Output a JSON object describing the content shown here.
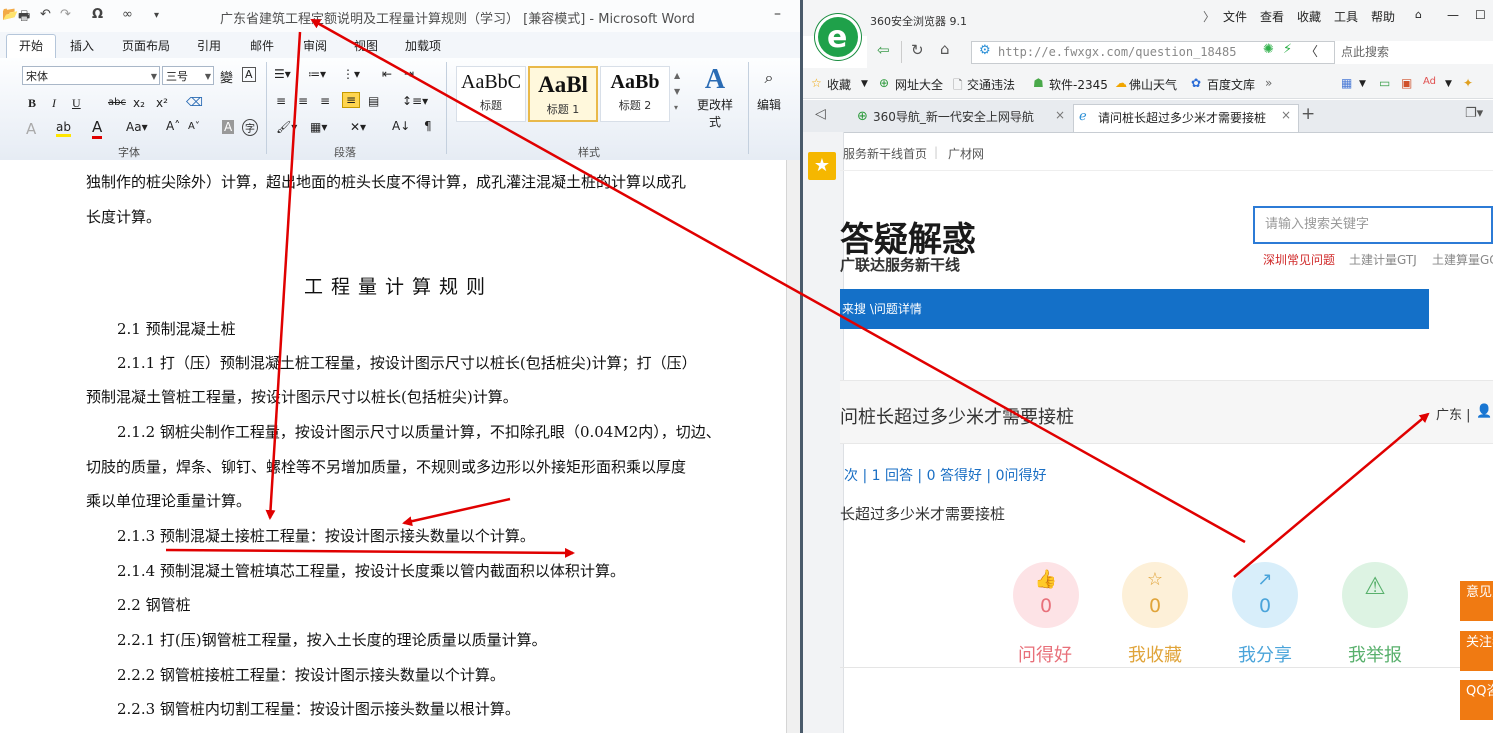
{
  "word": {
    "title": "广东省建筑工程定额说明及工程量计算规则（学习） [兼容模式] - Microsoft Word",
    "tabs": [
      "开始",
      "插入",
      "页面布局",
      "引用",
      "邮件",
      "审阅",
      "视图",
      "加载项"
    ],
    "font_name": "宋体",
    "font_size": "三号",
    "font_group_label": "字体",
    "paragraph_group_label": "段落",
    "styles_group_label": "样式",
    "styles": [
      {
        "sample": "AaBbC",
        "name": "标题"
      },
      {
        "sample": "AaBl",
        "name": "标题 1"
      },
      {
        "sample": "AaBb",
        "name": "标题 2"
      }
    ],
    "change_styles": "更改样式",
    "edit": "编辑",
    "doc_lines": [
      "独制作的桩尖除外）计算，超出地面的桩头长度不得计算，成孔灌注混凝土桩的计算以成孔",
      "长度计算。",
      "工程量计算规则",
      "2.1 预制混凝土桩",
      "2.1.1 打（压）预制混凝土桩工程量，按设计图示尺寸以桩长(包括桩尖)计算；打（压）",
      "预制混凝土管桩工程量，按设计图示尺寸以桩长(包括桩尖)计算。",
      "2.1.2 钢桩尖制作工程量，按设计图示尺寸以质量计算，不扣除孔眼（0.04M2内），切边、",
      "切肢的质量，焊条、铆钉、螺栓等不另增加质量，不规则或多边形以外接矩形面积乘以厚度",
      "乘以单位理论重量计算。",
      "2.1.3 预制混凝土接桩工程量：按设计图示接头数量以个计算。",
      "2.1.4 预制混凝土管桩填芯工程量，按设计长度乘以管内截面积以体积计算。",
      "2.2 钢管桩",
      "2.2.1 打(压)钢管桩工程量，按入土长度的理论质量以质量计算。",
      "2.2.2 钢管桩接桩工程量：按设计图示接头数量以个计算。",
      "2.2.3 钢管桩内切割工程量：按设计图示接头数量以根计算。"
    ]
  },
  "browser": {
    "title": "360安全浏览器 9.1",
    "menu": [
      "文件",
      "查看",
      "收藏",
      "工具",
      "帮助"
    ],
    "url": "http://e.fwxgx.com/question_18485",
    "search_placeholder": "点此搜索",
    "favorites": [
      "收藏",
      "网址大全",
      "交通违法",
      "软件-2345",
      "佛山天气",
      "百度文库"
    ],
    "tabs": [
      "360导航_新一代安全上网导航",
      "请问桩长超过多少米才需要接桩"
    ],
    "page": {
      "top_links": [
        "服务新干线首页",
        "广材网"
      ],
      "brand": "答疑解惑",
      "brand_sub": "广联达服务新干线",
      "search_placeholder": "请输入搜索关键字",
      "keywords": [
        "深圳常见问题",
        "土建计量GTJ",
        "土建算量GC"
      ],
      "breadcrumb": "来搜 \\问题详情",
      "question_title": "问桩长超过多少米才需要接桩",
      "location": "广东 | ",
      "stats": "次 | 1 回答 | 0 答得好 | 0问得好",
      "question_body": "长超过多少米才需要接桩",
      "actions": [
        {
          "label": "问得好",
          "count": "0",
          "icon": "thumbs-up-icon",
          "color": "#e8707a",
          "bg": "#fde3e6"
        },
        {
          "label": "我收藏",
          "count": "0",
          "icon": "star-icon",
          "color": "#e0a43a",
          "bg": "#fdf0d8"
        },
        {
          "label": "我分享",
          "count": "0",
          "icon": "share-icon",
          "color": "#4aa4da",
          "bg": "#d8eefa"
        },
        {
          "label": "我举报",
          "count": "",
          "icon": "warning-icon",
          "color": "#58b06c",
          "bg": "#ddf3e3"
        }
      ],
      "side_buttons": [
        "意见反馈",
        "关注我们",
        "QQ咨询"
      ]
    }
  },
  "colors": {
    "annotation_red": "#e00000",
    "word_accent": "#2b579a",
    "brand_blue": "#1470c8",
    "side_orange": "#f07a12"
  }
}
